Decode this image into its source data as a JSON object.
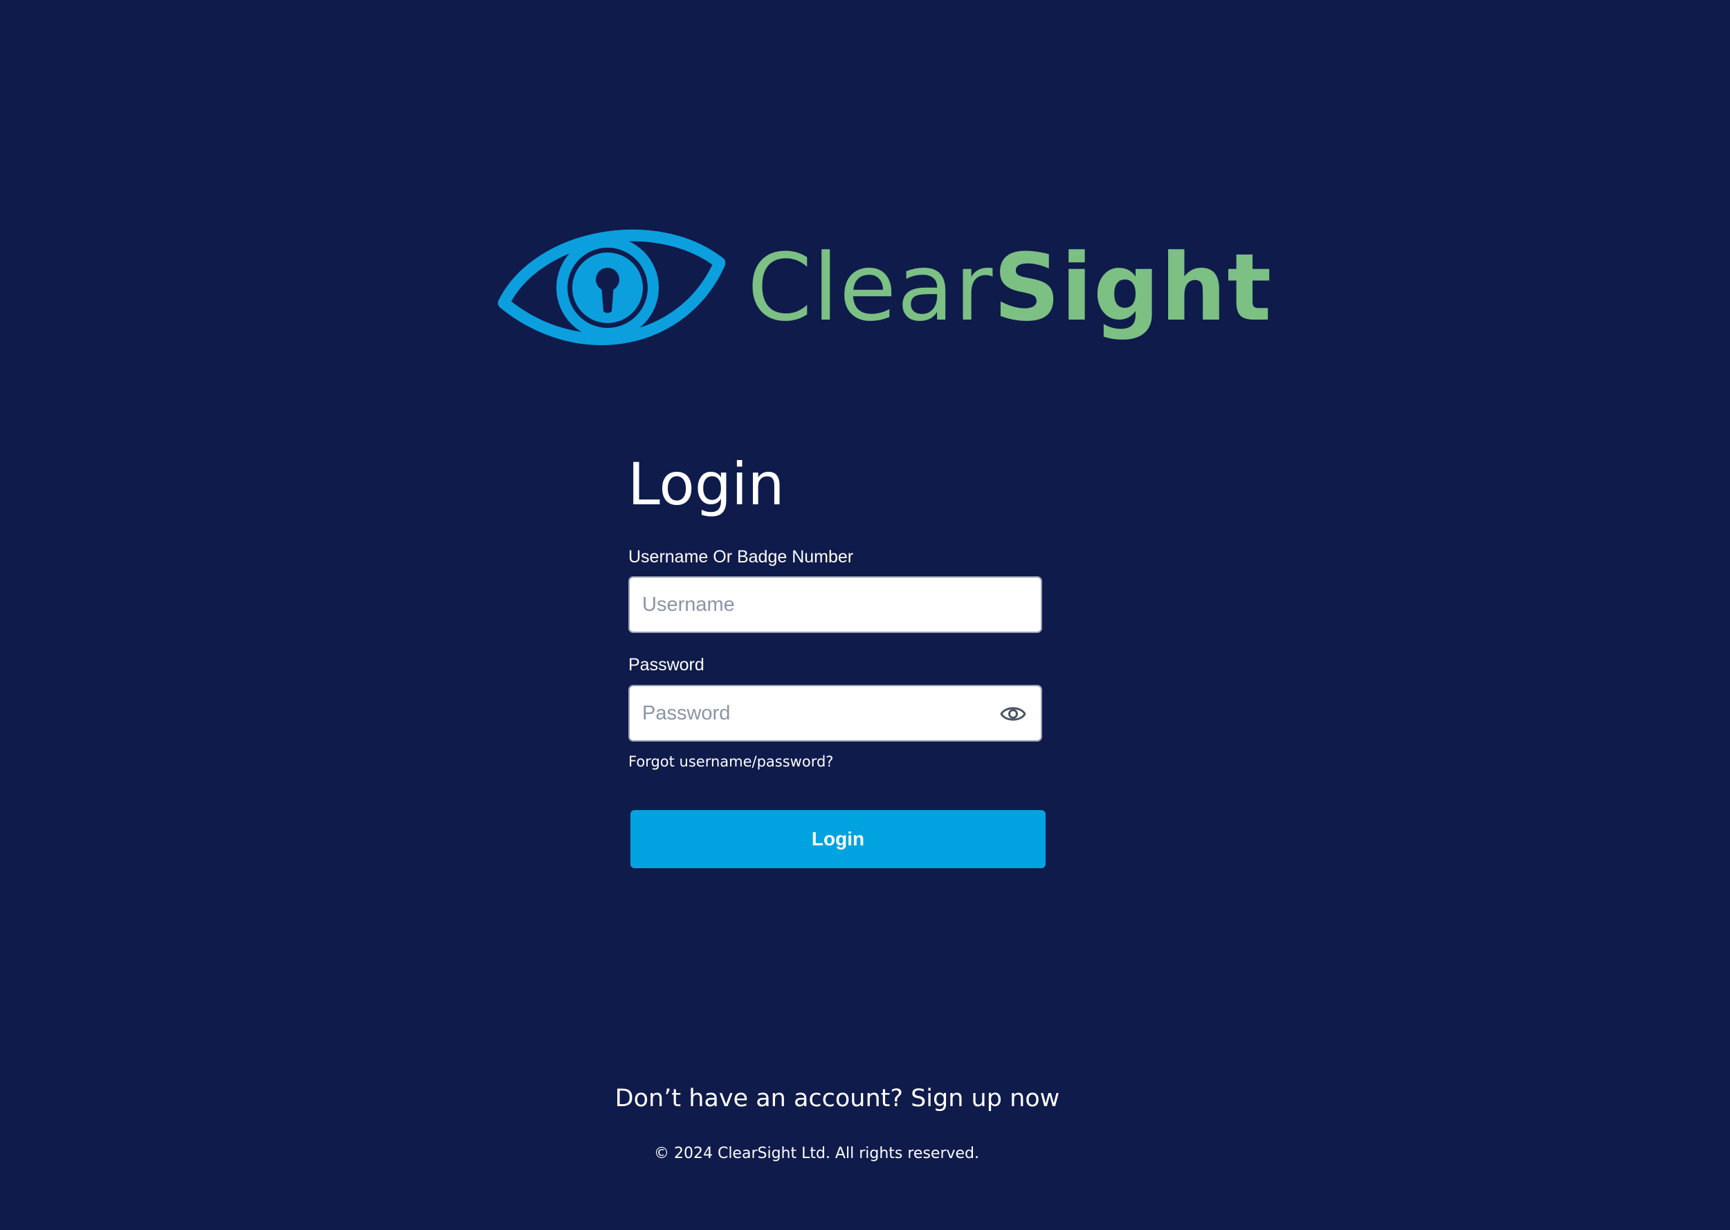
{
  "brand": {
    "name_light": "Clear",
    "name_bold": "Sight",
    "logo_icon": "eye-keyhole-icon",
    "logo_color": "#0b9fde",
    "text_color": "#7cc084"
  },
  "login": {
    "title": "Login",
    "username_label": "Username Or Badge Number",
    "username_placeholder": "Username",
    "username_value": "",
    "password_label": "Password",
    "password_placeholder": "Password",
    "password_value": "",
    "password_toggle_icon": "eye-icon",
    "forgot_link": "Forgot username/password?",
    "submit_label": "Login"
  },
  "footer": {
    "signup_prefix": "Don’t have an account? ",
    "signup_link": "Sign up now",
    "copyright": "© 2024 ClearSight Ltd. All rights reserved."
  },
  "colors": {
    "background": "#0f1b4b",
    "accent": "#00a3e0"
  }
}
